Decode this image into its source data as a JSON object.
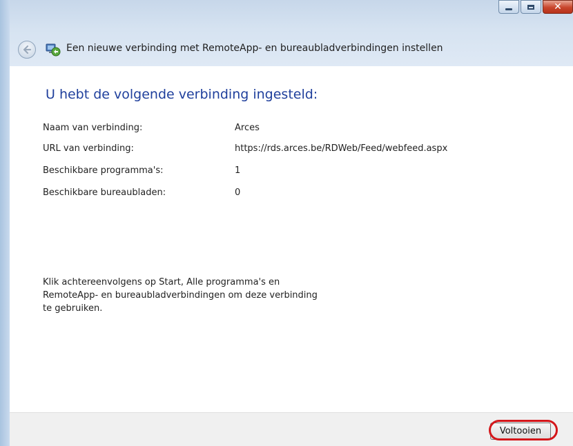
{
  "window": {
    "title": "Een nieuwe verbinding met RemoteApp- en bureaubladverbindingen instellen",
    "close_glyph": "✕",
    "icons": {
      "back": "back-arrow-icon",
      "app": "remoteapp-connection-icon",
      "minimize": "minimize-icon",
      "maximize": "maximize-icon",
      "close": "close-icon"
    }
  },
  "content": {
    "heading": "U hebt de volgende verbinding ingesteld:",
    "details": [
      {
        "label": "Naam van verbinding:",
        "value": "Arces"
      },
      {
        "label": "URL van verbinding:",
        "value": "https://rds.arces.be/RDWeb/Feed/webfeed.aspx"
      },
      {
        "label": "Beschikbare programma's:",
        "value": "1"
      },
      {
        "label": "Beschikbare bureaubladen:",
        "value": "0"
      }
    ],
    "note": "Klik achtereenvolgens op Start, Alle programma's en RemoteApp- en bureaubladverbindingen om deze verbinding te gebruiken."
  },
  "footer": {
    "finish_label": "Voltooien"
  },
  "colors": {
    "heading": "#1f3f9c",
    "highlight": "#d4161a",
    "close_button": "#c8452c"
  }
}
